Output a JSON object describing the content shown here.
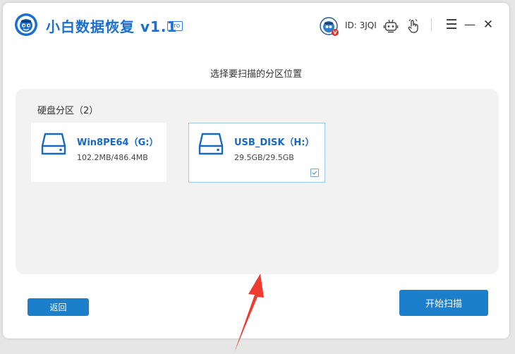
{
  "app": {
    "title": "小白数据恢复 v1.1",
    "badge": "Pro",
    "brand_color": "#1a6fd0",
    "accent_color": "#1b7fcc"
  },
  "user": {
    "id_label": "ID: 3JQI",
    "avatar_icon": "user-avatar-icon"
  },
  "toolbar": {
    "icons": [
      "robot-icon",
      "hand-pointer-icon"
    ],
    "menu_label": "☰",
    "minimize_label": "—",
    "close_label": "✕"
  },
  "main": {
    "heading": "选择要扫描的分区位置",
    "section_title": "硬盘分区（2）",
    "partitions": [
      {
        "name": "Win8PE64（G:）",
        "size": "102.2MB/486.4MB",
        "selected": false,
        "icon": "hard-drive-icon"
      },
      {
        "name": "USB_DISK（H:）",
        "size": "29.5GB/29.5GB",
        "selected": true,
        "icon": "hard-drive-icon"
      }
    ]
  },
  "footer": {
    "back_label": "返回",
    "scan_label": "开始扫描"
  }
}
